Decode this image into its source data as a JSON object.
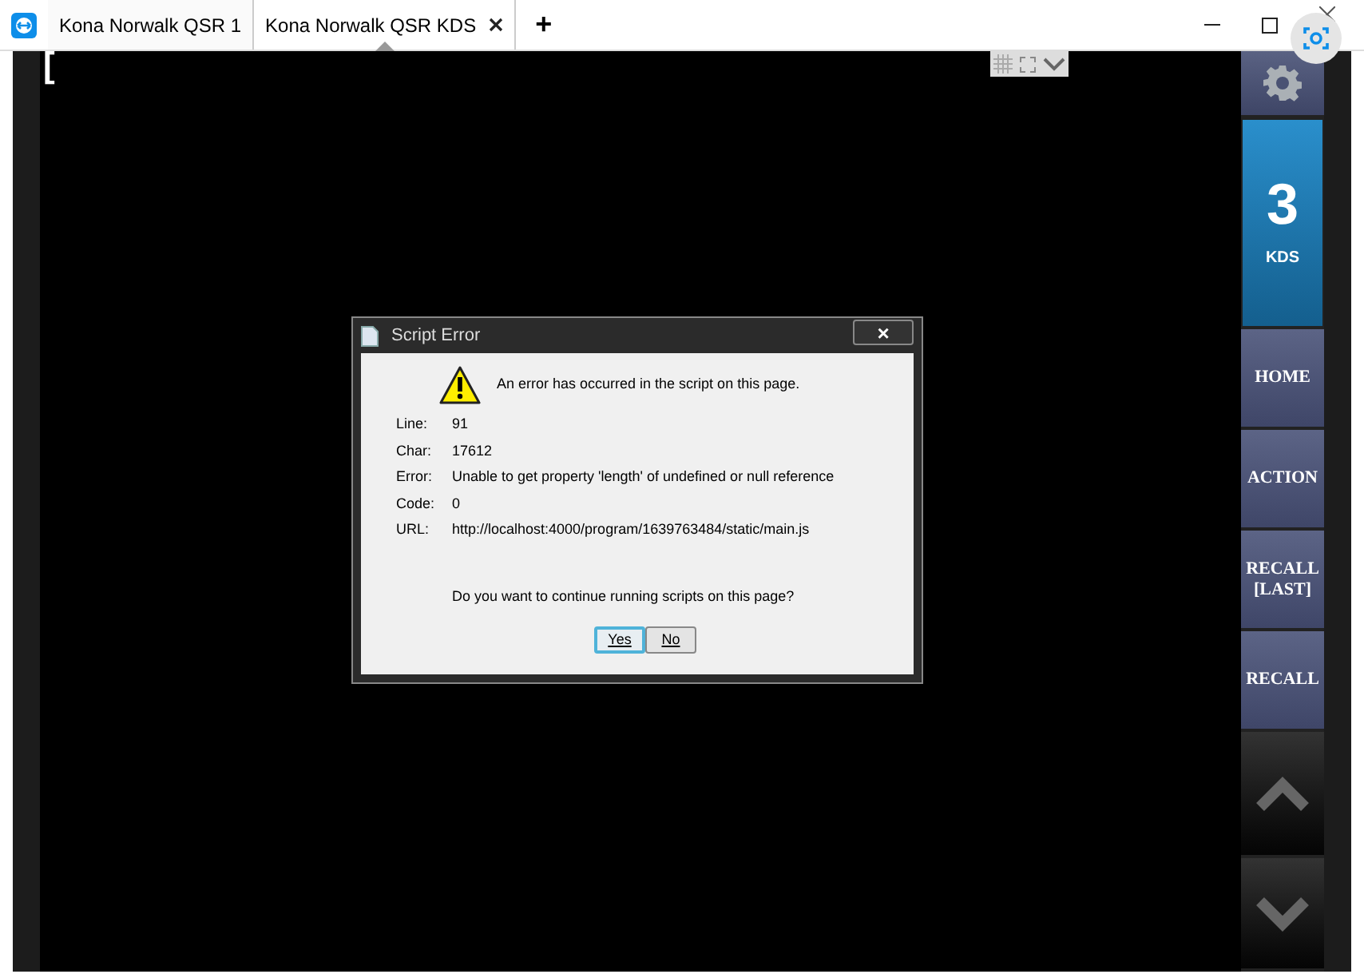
{
  "tabs": [
    {
      "label": "Kona Norwalk QSR 1",
      "selected": false,
      "closable": false
    },
    {
      "label": "Kona Norwalk QSR KDS",
      "selected": true,
      "closable": true
    }
  ],
  "new_tab": "+",
  "screen": {
    "cursor_text": "["
  },
  "dialog": {
    "title": "Script Error",
    "close": "×",
    "message": "An error has occurred in the script on this page.",
    "details": [
      {
        "label": "Line:",
        "value": "91"
      },
      {
        "label": "Char:",
        "value": "17612"
      },
      {
        "label": "Error:",
        "value": "Unable to get property 'length' of undefined or null reference"
      },
      {
        "label": "Code:",
        "value": "0"
      },
      {
        "label": "URL:",
        "value": "http://localhost:4000/program/1639763484/static/main.js"
      }
    ],
    "question": "Do you want to continue running scripts on this page?",
    "buttons": [
      {
        "label": "Yes",
        "focused": true
      },
      {
        "label": "No",
        "focused": false
      }
    ]
  },
  "sidebar": [
    {
      "kind": "settings"
    },
    {
      "kind": "screen",
      "number": "3",
      "label": "KDS",
      "selected": true
    },
    {
      "kind": "text",
      "label": "HOME"
    },
    {
      "kind": "text",
      "label": "ACTION"
    },
    {
      "kind": "text",
      "label": "RECALL [LAST]"
    },
    {
      "kind": "text",
      "label": "RECALL"
    },
    {
      "kind": "up"
    },
    {
      "kind": "down"
    }
  ]
}
